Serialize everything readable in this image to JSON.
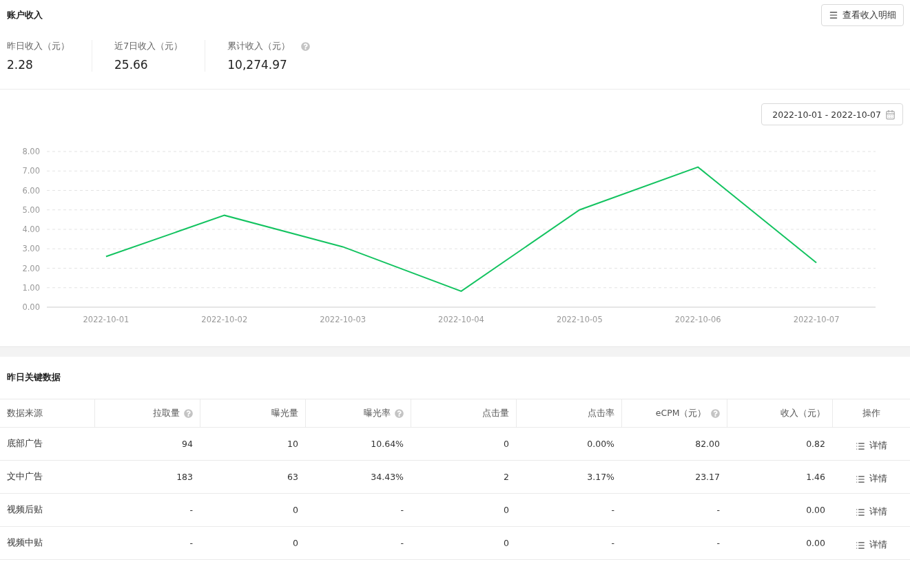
{
  "account": {
    "title": "账户收入",
    "detail_button": "查看收入明细",
    "stats": [
      {
        "label": "昨日收入（元）",
        "value": "2.28",
        "help": false
      },
      {
        "label": "近7日收入（元）",
        "value": "25.66",
        "help": false
      },
      {
        "label": "累计收入（元）",
        "value": "10,274.97",
        "help": true
      }
    ]
  },
  "trend": {
    "date_range": "2022-10-01 - 2022-10-07",
    "chart_data": {
      "type": "line",
      "categories": [
        "2022-10-01",
        "2022-10-02",
        "2022-10-03",
        "2022-10-04",
        "2022-10-05",
        "2022-10-06",
        "2022-10-07"
      ],
      "grid": true,
      "series": [
        {
          "color": "#13c360",
          "values": [
            2.6,
            4.72,
            3.1,
            0.82,
            5.0,
            7.2,
            2.28
          ]
        }
      ],
      "ylim": [
        0,
        8
      ],
      "yticks": [
        {
          "value": 0,
          "label": "0.00"
        },
        {
          "value": 1,
          "label": "1.00"
        },
        {
          "value": 2,
          "label": "2.00"
        },
        {
          "value": 3,
          "label": "3.00"
        },
        {
          "value": 4,
          "label": "4.00"
        },
        {
          "value": 5,
          "label": "5.00"
        },
        {
          "value": 6,
          "label": "6.00"
        },
        {
          "value": 7,
          "label": "7.00"
        },
        {
          "value": 8,
          "label": "8.00"
        }
      ]
    }
  },
  "key_data": {
    "title": "昨日关键数据",
    "columns": [
      {
        "label": "数据来源",
        "help": false
      },
      {
        "label": "拉取量",
        "help": true
      },
      {
        "label": "曝光量",
        "help": false
      },
      {
        "label": "曝光率",
        "help": true
      },
      {
        "label": "点击量",
        "help": false
      },
      {
        "label": "点击率",
        "help": false
      },
      {
        "label": "eCPM（元）",
        "help": true
      },
      {
        "label": "收入（元）",
        "help": false
      },
      {
        "label": "操作",
        "help": false
      }
    ],
    "rows": [
      {
        "cells": [
          "底部广告",
          "94",
          "10",
          "10.64%",
          "0",
          "0.00%",
          "82.00",
          "0.82"
        ],
        "action": "详情"
      },
      {
        "cells": [
          "文中广告",
          "183",
          "63",
          "34.43%",
          "2",
          "3.17%",
          "23.17",
          "1.46"
        ],
        "action": "详情"
      },
      {
        "cells": [
          "视频后贴",
          "-",
          "0",
          "-",
          "0",
          "-",
          "-",
          "0.00"
        ],
        "action": "详情"
      },
      {
        "cells": [
          "视频中贴",
          "-",
          "0",
          "-",
          "0",
          "-",
          "-",
          "0.00"
        ],
        "action": "详情"
      }
    ]
  }
}
